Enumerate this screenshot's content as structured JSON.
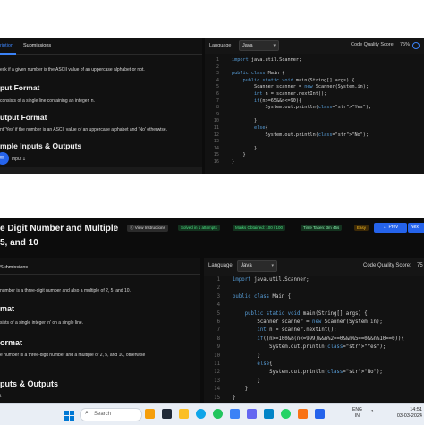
{
  "top_screen": {
    "tabs": {
      "active": "ription",
      "other": "Submissions"
    },
    "problem": {
      "statement": "eck if a given number is the ASCII value of an uppercase alphabet or not.",
      "input_heading": "put Format",
      "input_text": "consists of a single line containing an integer, n.",
      "output_heading": "utput Format",
      "output_text": "nt 'Yes' if the number is an ASCII value of an uppercase alphabet and 'No' otherwise.",
      "samples_heading": "mple Inputs & Outputs",
      "sample_label": "Input 1"
    },
    "editor": {
      "language_label": "Language",
      "language_value": "Java",
      "quality_label": "Code Quality Score:",
      "quality_value": "75%",
      "lines": [
        {
          "n": "1",
          "text": "import java.util.Scanner;"
        },
        {
          "n": "2",
          "text": ""
        },
        {
          "n": "3",
          "text": "public class Main {"
        },
        {
          "n": "4",
          "text": "    public static void main(String[] args) {"
        },
        {
          "n": "5",
          "text": "        Scanner scanner = new Scanner(System.in);"
        },
        {
          "n": "6",
          "text": "        int n = scanner.nextInt();"
        },
        {
          "n": "7",
          "text": "        if(n>=65&&n<=90){"
        },
        {
          "n": "8",
          "text": "            System.out.println(\"Yes\");"
        },
        {
          "n": "9",
          "text": ""
        },
        {
          "n": "10",
          "text": "        }"
        },
        {
          "n": "11",
          "text": "        else{"
        },
        {
          "n": "12",
          "text": "            System.out.println(\"No\");"
        },
        {
          "n": "13",
          "text": ""
        },
        {
          "n": "14",
          "text": "        }"
        },
        {
          "n": "15",
          "text": "    }"
        },
        {
          "n": "16",
          "text": "}"
        }
      ]
    }
  },
  "bottom_screen": {
    "title_line1": "e Digit Number and Multiple",
    "title_line2": "5, and 10",
    "header": {
      "view_instructions": "View Instructions",
      "solved": "Solved in 1 attempts",
      "marks": "Marks Obtained: 100 / 100",
      "time": "Time Taken: 3m 45s",
      "difficulty": "Easy",
      "prev": "Prev",
      "next": "Nex"
    },
    "tabs": {
      "other": "Submissions"
    },
    "problem": {
      "statement": "number is a three-digit number and also a multiple of 2, 5, and 10.",
      "input_heading": "mat",
      "input_text": "sists of a single integer 'n' on a single line.",
      "output_heading": "ormat",
      "output_text": "e number is a three-digit number and a multiple of 2, 5, and 10, otherwise",
      "samples_heading": "puts & Outputs",
      "sample_label": "t"
    },
    "editor": {
      "language_label": "Language",
      "language_value": "Java",
      "quality_label": "Code Quality Score:",
      "quality_value": "75",
      "lines": [
        {
          "n": "1",
          "text": "import java.util.Scanner;"
        },
        {
          "n": "2",
          "text": ""
        },
        {
          "n": "3",
          "text": "public class Main {"
        },
        {
          "n": "4",
          "text": ""
        },
        {
          "n": "5",
          "text": "    public static void main(String[] args) {"
        },
        {
          "n": "6",
          "text": "        Scanner scanner = new Scanner(System.in);"
        },
        {
          "n": "7",
          "text": "        int n = scanner.nextInt();"
        },
        {
          "n": "8",
          "text": "        if((n>=100&&(n<=999)&&n%2==0&&n%5==0&&n%10==0)){"
        },
        {
          "n": "9",
          "text": "            System.out.println(\"Yes\");"
        },
        {
          "n": "10",
          "text": "        }"
        },
        {
          "n": "11",
          "text": "        else{"
        },
        {
          "n": "12",
          "text": "            System.out.println(\"No\");"
        },
        {
          "n": "13",
          "text": "        }"
        },
        {
          "n": "14",
          "text": "    }"
        },
        {
          "n": "15",
          "text": "}"
        }
      ]
    }
  },
  "taskbar": {
    "search_placeholder": "Search",
    "lang": "ENG",
    "region": "IN",
    "time": "14:51",
    "date": "03-03-2024",
    "icons": [
      "windows-icon",
      "search-icon",
      "game-icon",
      "task-view-icon",
      "file-explorer-icon",
      "edge-icon",
      "chrome-icon",
      "store-icon",
      "photos-icon",
      "whatsapp-icon",
      "folder-icon",
      "vscode-icon"
    ]
  },
  "colors": {
    "accent": "#3b82f6",
    "editor_bg": "#121212",
    "solved_green": "#16a34a",
    "easy_orange": "#d97706"
  }
}
